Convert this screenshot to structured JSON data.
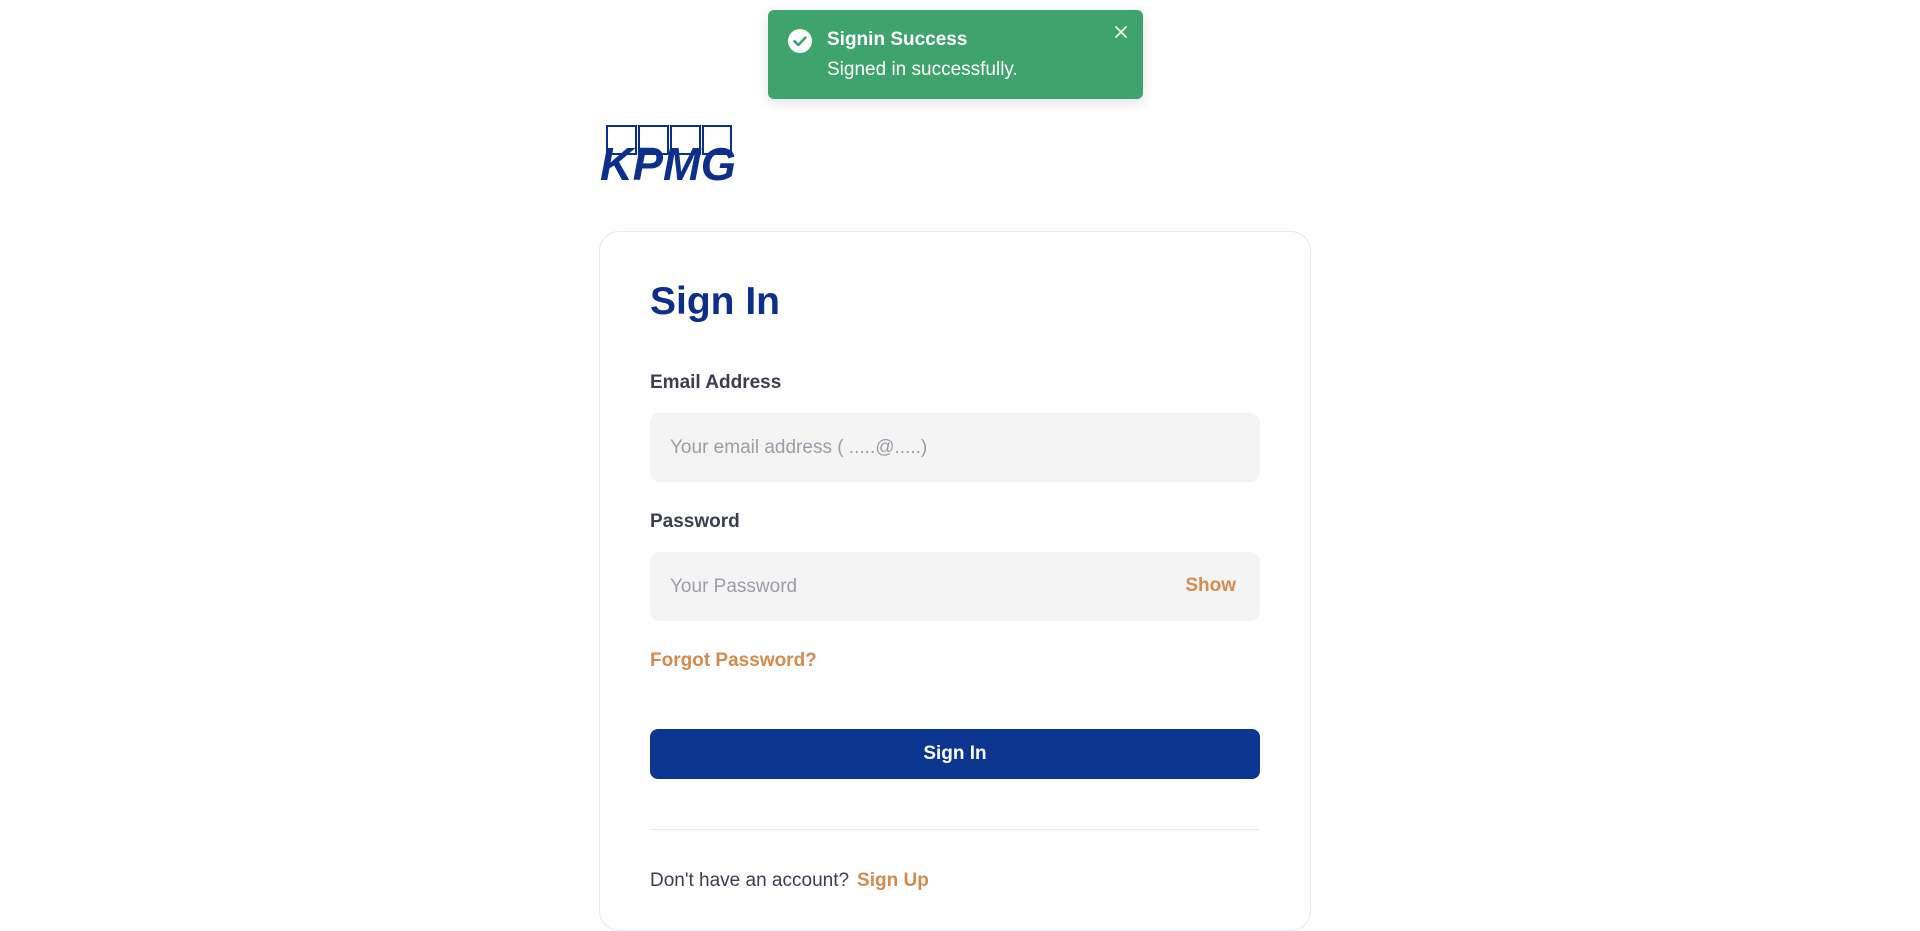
{
  "toast": {
    "title": "Signin Success",
    "message": "Signed in successfully.",
    "icon": "check-circle-icon",
    "close_icon": "close-icon",
    "color": "#3ea36c"
  },
  "logo": {
    "text": "KPMG",
    "color": "#0b2f8a"
  },
  "form": {
    "title": "Sign In",
    "email": {
      "label": "Email Address",
      "placeholder": "Your email address ( .....@.....)",
      "value": ""
    },
    "password": {
      "label": "Password",
      "placeholder": "Your Password",
      "value": "",
      "toggle_label": "Show"
    },
    "forgot_label": "Forgot Password?",
    "submit_label": "Sign In",
    "footer_text": "Don't have an account?",
    "signup_label": "Sign Up"
  },
  "colors": {
    "primary": "#0b358f",
    "accent": "#d58a4e",
    "title": "#0b2f8a",
    "input_bg": "#f4f4f5"
  }
}
